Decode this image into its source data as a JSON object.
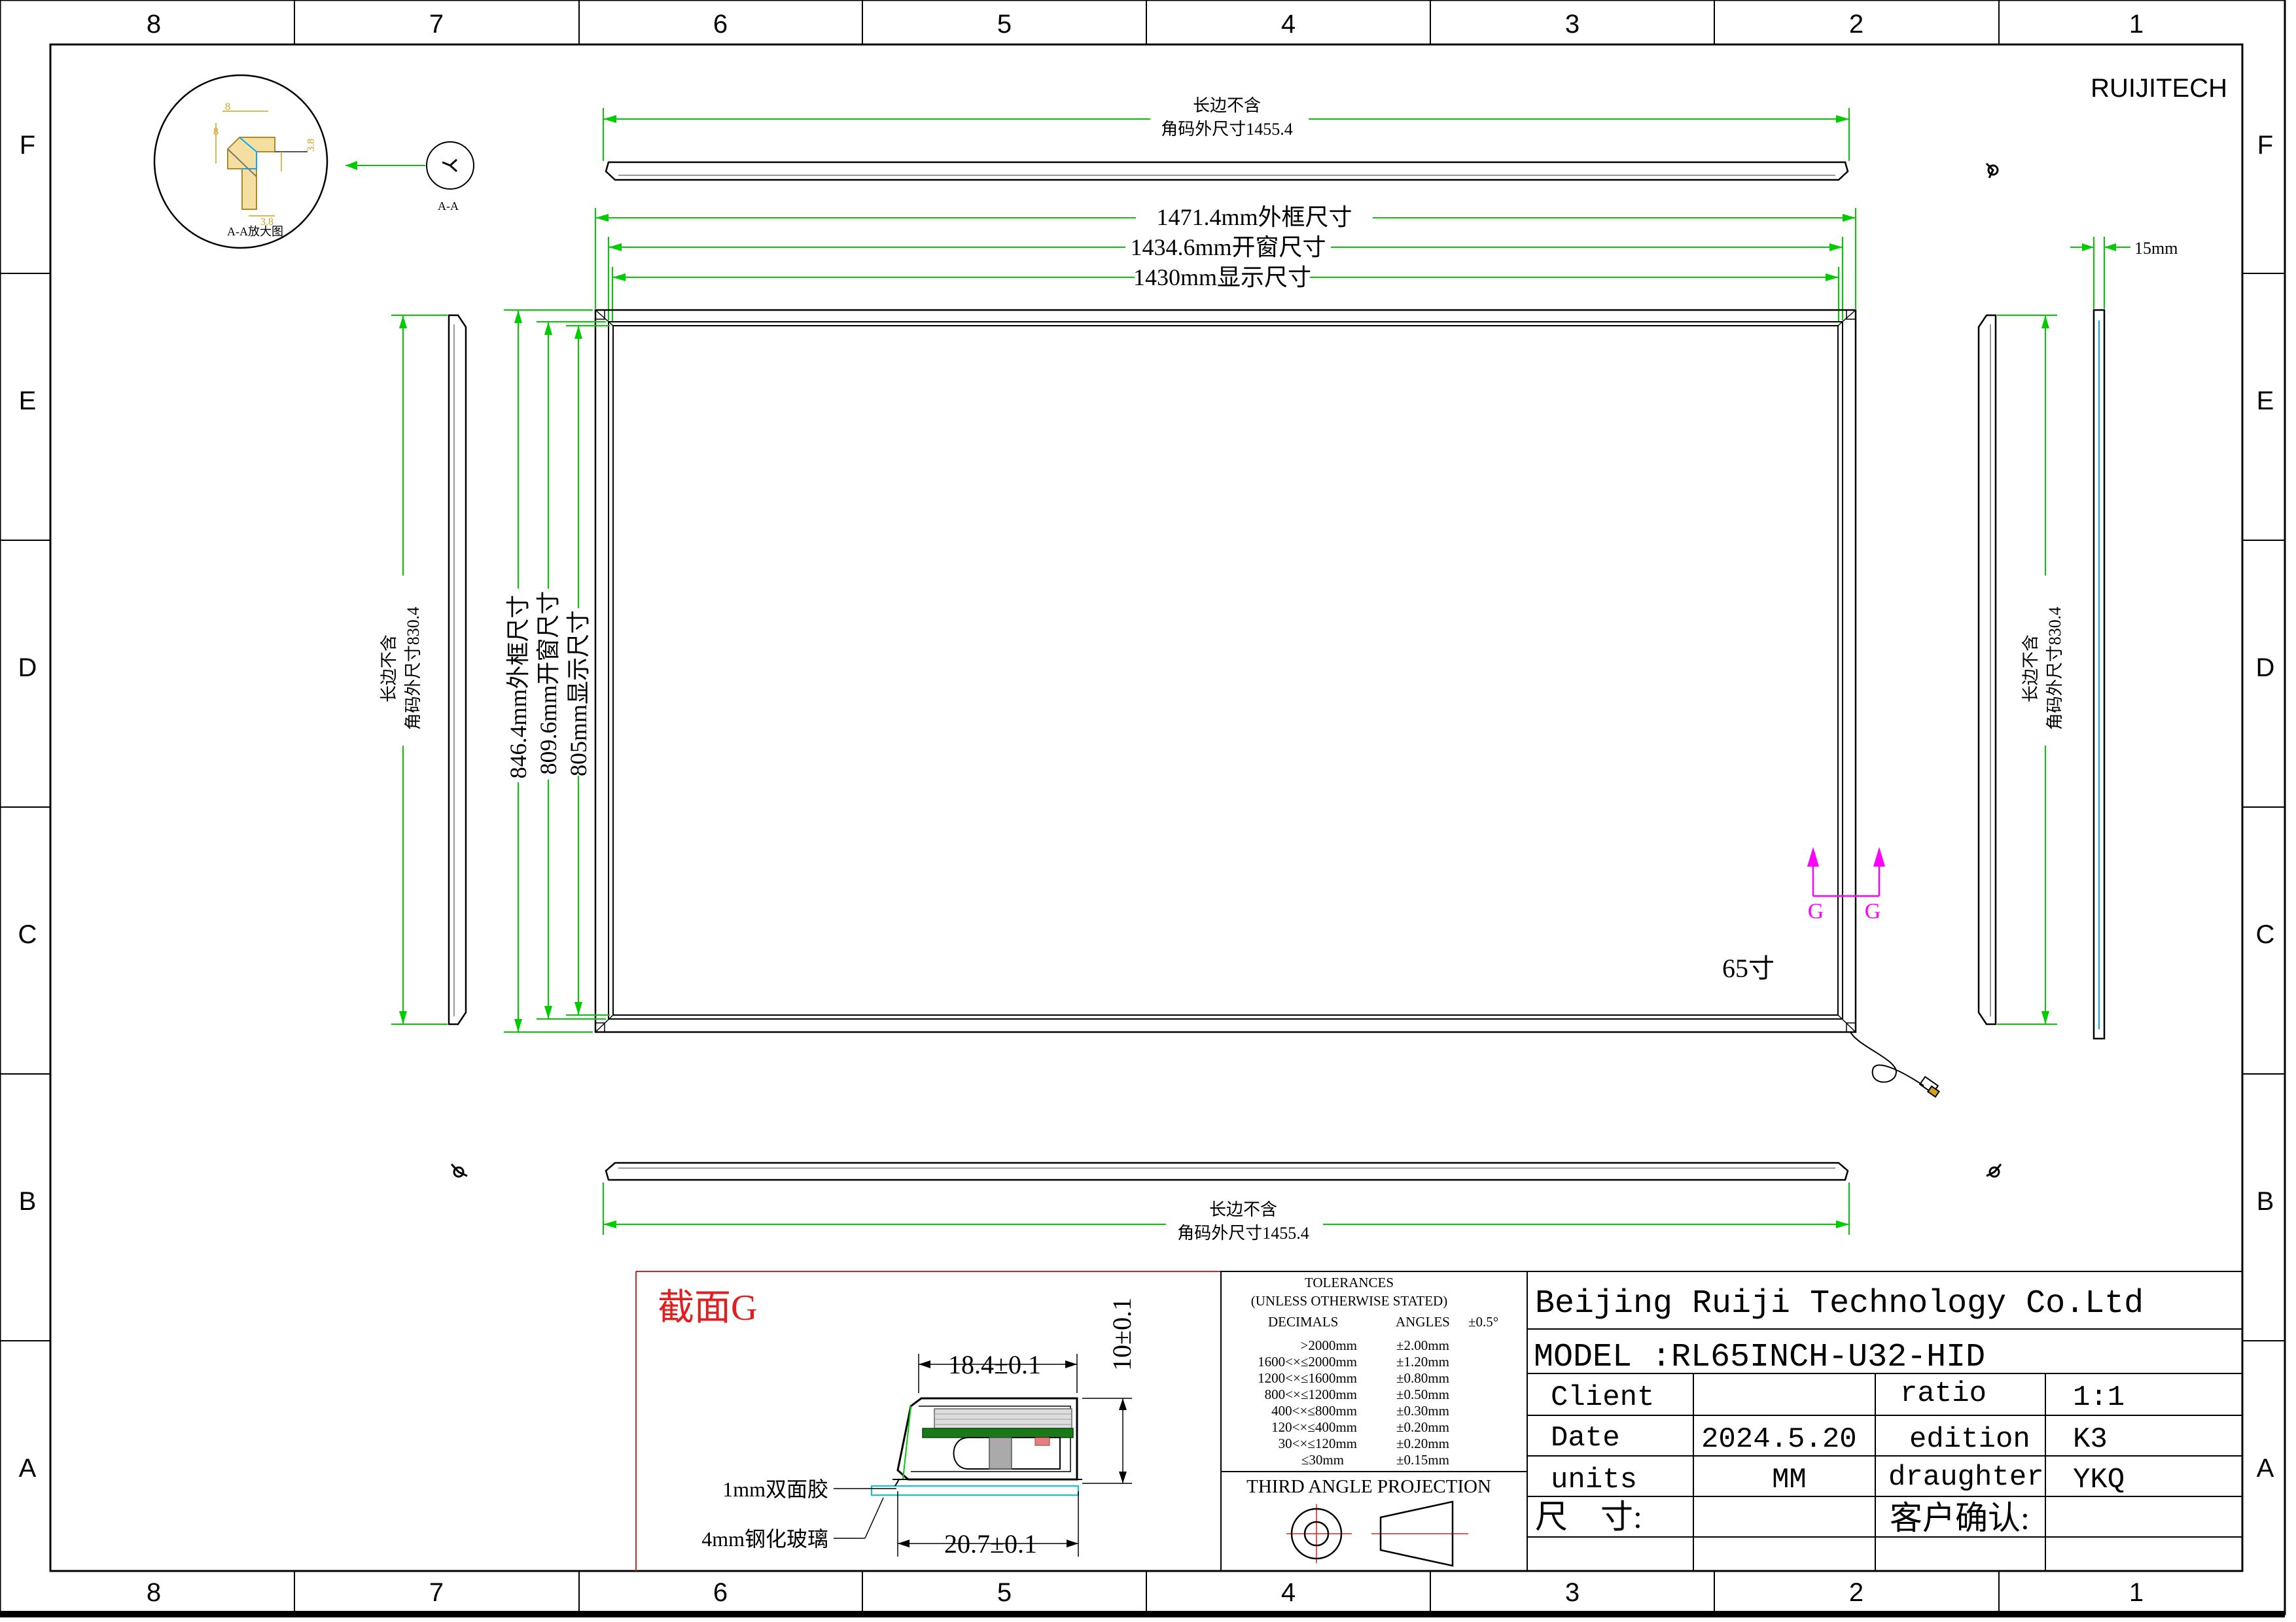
{
  "border": {
    "columns": [
      "8",
      "7",
      "6",
      "5",
      "4",
      "3",
      "2",
      "1"
    ],
    "rows": [
      "F",
      "E",
      "D",
      "C",
      "B",
      "A"
    ]
  },
  "brand": "RUIJITECH",
  "detail": {
    "caption": "A-A放大图",
    "ref_label": "A-A",
    "dims": [
      "8",
      "8",
      "3.8",
      "3.8"
    ]
  },
  "dimensions": {
    "top_rail_l1": "长边不含",
    "top_rail_l2": "角码外尺寸1455.4",
    "bottom_rail_l1": "长边不含",
    "bottom_rail_l2": "角码外尺寸1455.4",
    "left_rail_l1": "长边不含",
    "left_rail_l2": "角码外尺寸830.4",
    "right_rail_l1": "长边不含",
    "right_rail_l2": "角码外尺寸830.4",
    "outer_w": "1471.4mm外框尺寸",
    "window_w": "1434.6mm开窗尺寸",
    "display_w": "1430mm显示尺寸",
    "outer_h": "846.4mm外框尺寸",
    "window_h": "809.6mm开窗尺寸",
    "display_h": "805mm显示尺寸",
    "depth": "15mm"
  },
  "size_label": "65寸",
  "section_marker": "G",
  "section": {
    "title": "截面G",
    "top_w": "18.4±0.1",
    "bottom_w": "20.7±0.1",
    "height": "10±0.1",
    "tape": "1mm双面胶",
    "glass": "4mm钢化玻璃"
  },
  "tolerances": {
    "title": "TOLERANCES",
    "subtitle": "(UNLESS OTHERWISE STATED)",
    "decimals": "DECIMALS",
    "angles": "ANGLES",
    "angle_value": "±0.5°",
    "rows": [
      {
        "range": ">2000mm",
        "tol": "±2.00mm"
      },
      {
        "range": "1600<×≤2000mm",
        "tol": "±1.20mm"
      },
      {
        "range": "1200<×≤1600mm",
        "tol": "±0.80mm"
      },
      {
        "range": "800<×≤1200mm",
        "tol": "±0.50mm"
      },
      {
        "range": "400<×≤800mm",
        "tol": "±0.30mm"
      },
      {
        "range": "120<×≤400mm",
        "tol": "±0.20mm"
      },
      {
        "range": "30<×≤120mm",
        "tol": "±0.20mm"
      },
      {
        "range": "≤30mm",
        "tol": "±0.15mm"
      }
    ],
    "projection": "THIRD ANGLE PROJECTION"
  },
  "title_block": {
    "company": "Beijing Ruiji Technology Co.Ltd",
    "model": "MODEL :RL65INCH-U32-HID",
    "client_label": "Client",
    "client_value": "",
    "ratio_label": "ratio",
    "ratio_value": "1:1",
    "date_label": "Date",
    "date_value": "2024.5.20",
    "edition_label": "edition",
    "edition_value": "K3",
    "units_label": "units",
    "units_value": "MM",
    "draughter_label": "draughter",
    "draughter_value": "YKQ",
    "size_field_label": "尺    寸:",
    "confirm_label": "客户确认:"
  },
  "colors": {
    "line": "#000000",
    "dimension": "#00cc00",
    "section_marker": "#ff00ff",
    "section_title": "#e02020",
    "section_frame": "#e02020",
    "pcb": "#1a7a1a",
    "gold": "#d4a017",
    "cyan": "#00c8e0"
  }
}
